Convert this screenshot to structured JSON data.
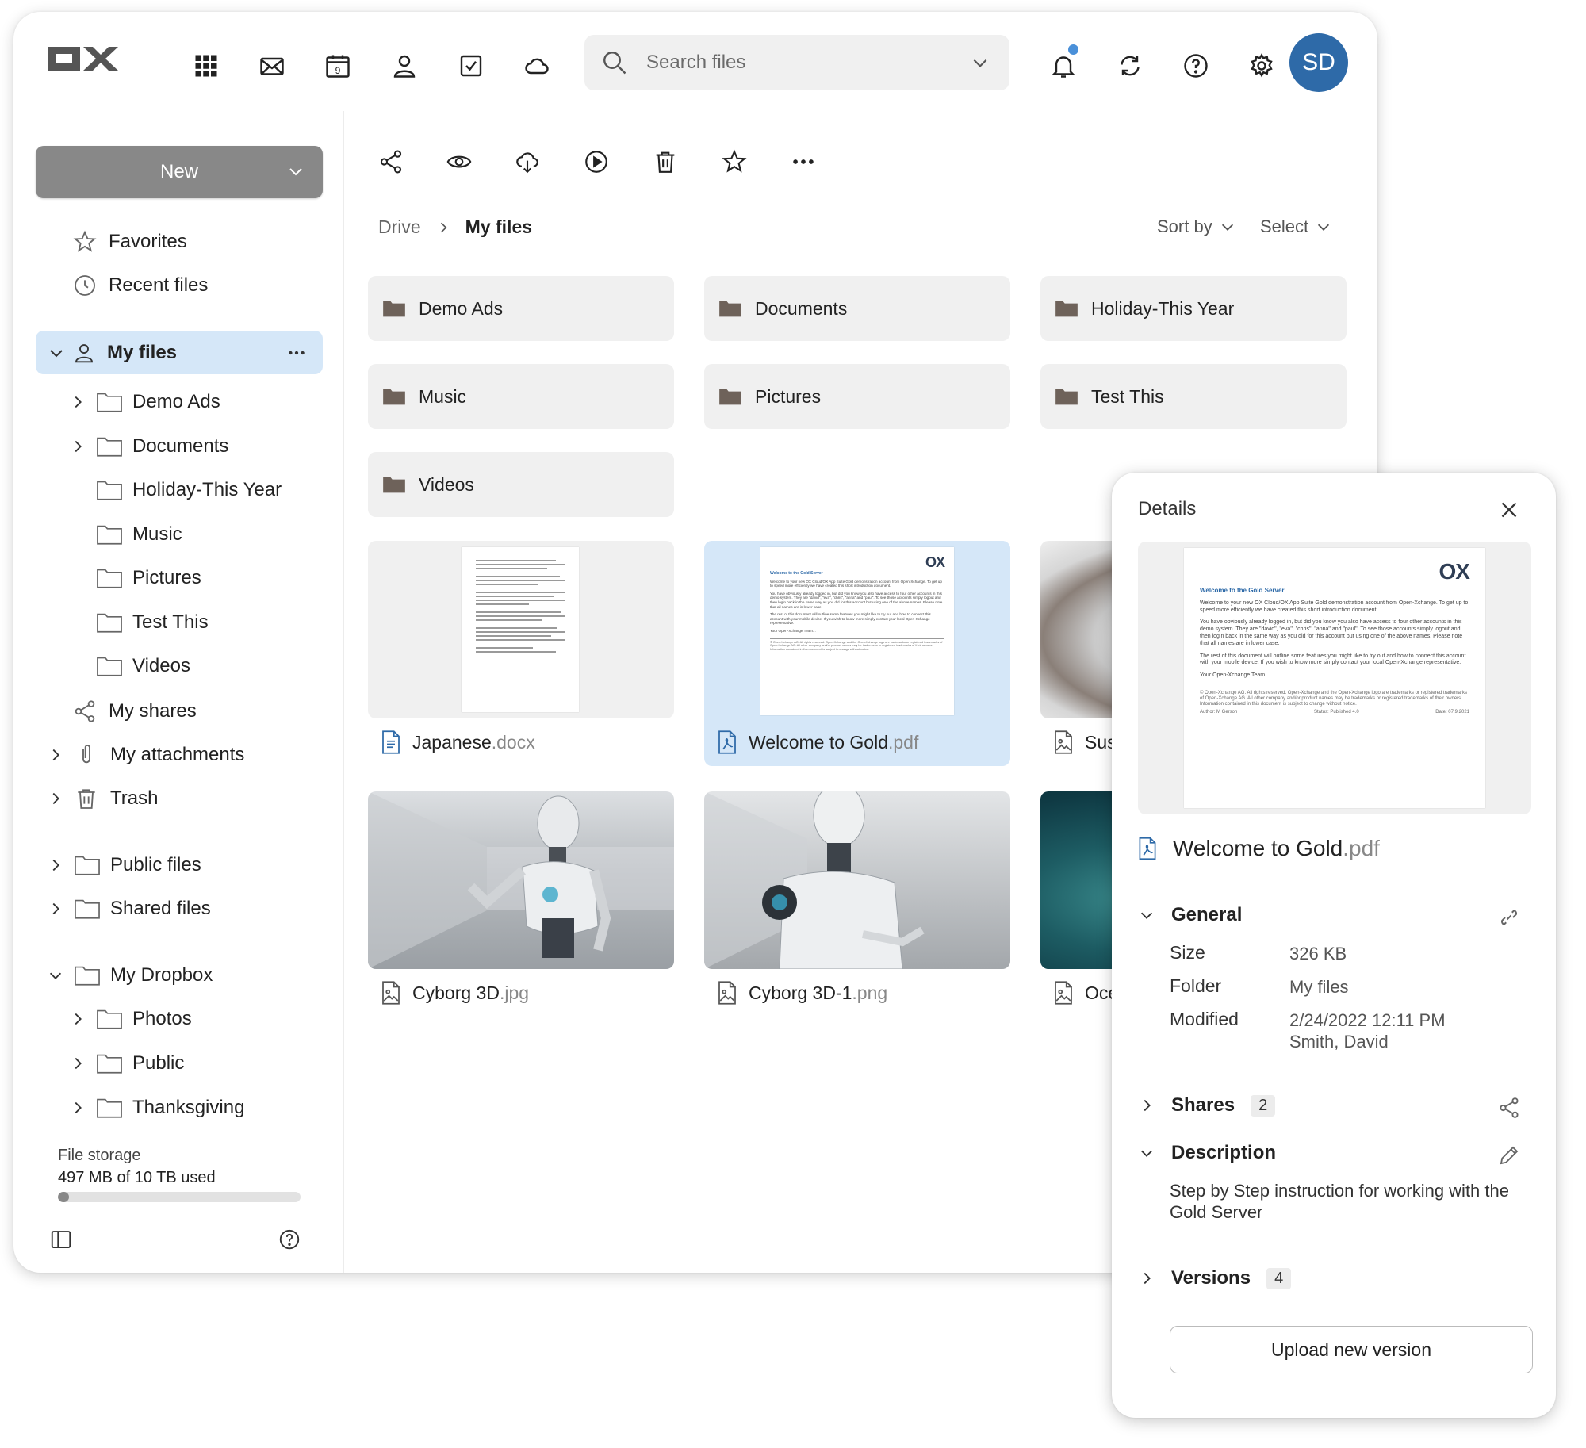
{
  "topbar": {
    "logo_text": "OX",
    "apps": [
      {
        "icon": "grid-icon"
      },
      {
        "icon": "mail-icon"
      },
      {
        "icon": "calendar-icon",
        "badge": "9"
      },
      {
        "icon": "contacts-icon"
      },
      {
        "icon": "tasks-icon"
      },
      {
        "icon": "cloud-icon"
      }
    ],
    "search": {
      "placeholder": "Search files",
      "value": ""
    },
    "avatar_initials": "SD",
    "colors": {
      "accent": "#2e6aa8",
      "selection": "#d5e7f8",
      "notification": "#4a90d9"
    }
  },
  "sidebar": {
    "new_label": "New",
    "favorites": "Favorites",
    "recent": "Recent files",
    "my_files": "My files",
    "my_files_children": [
      "Demo Ads",
      "Documents",
      "Holiday-This Year",
      "Music",
      "Pictures",
      "Test This",
      "Videos"
    ],
    "my_shares": "My shares",
    "my_attachments": "My attachments",
    "trash": "Trash",
    "public_files": "Public files",
    "shared_files": "Shared files",
    "my_dropbox": "My Dropbox",
    "dropbox_children": [
      "Photos",
      "Public",
      "Thanksgiving"
    ],
    "storage": {
      "title": "File storage",
      "value": "497 MB of 10 TB used",
      "used_fraction": 0.0001
    }
  },
  "main": {
    "breadcrumb": {
      "root": "Drive",
      "current": "My files"
    },
    "sort_label": "Sort by",
    "select_label": "Select",
    "folders": [
      "Demo Ads",
      "Documents",
      "Holiday-This Year",
      "Music",
      "Pictures",
      "Test This",
      "Videos"
    ],
    "files": [
      {
        "base": "Japanese",
        "ext": ".docx"
      },
      {
        "base": "Welcome to Gold",
        "ext": ".pdf"
      },
      {
        "base": "Sush",
        "ext": ""
      },
      {
        "base": "Cyborg 3D",
        "ext": ".jpg"
      },
      {
        "base": "Cyborg 3D-1",
        "ext": ".png"
      },
      {
        "base": "Oce",
        "ext": ""
      }
    ],
    "doc_preview": {
      "logo": "OX",
      "heading": "Welcome to the Gold Server",
      "p1": "Welcome to your new OX Cloud/OX App Suite Gold demonstration account from Open-Xchange. To get up to speed more efficiently we have created this short introduction document.",
      "p2": "You have obviously already logged in, but did you know you also have access to four other accounts in this demo system. They are \"david\", \"eva\", \"chris\", \"anna\" and \"paul\". To see those accounts simply logout and then login back in the same way as you did for this account but using one of the above names. Please note that all names are in lower case.",
      "p3": "The rest of this document will outline some features you might like to try out and how to connect this account with your mobile device. If you wish to know more simply contact your local Open-Xchange representative.",
      "p4": "Your Open-Xchange Team...",
      "footer": "© Open-Xchange AG. All rights reserved. Open-Xchange and the Open-Xchange logo are trademarks or registered trademarks of Open-Xchange AG. All other company and/or product names may be trademarks or registered trademarks of their owners. Information contained in this document is subject to change without notice.",
      "author": "Author: M Gerson",
      "status": "Status: Published 4.0",
      "date": "Date: 07.9.2021"
    }
  },
  "details": {
    "title": "Details",
    "file_base": "Welcome to Gold",
    "file_ext": ".pdf",
    "general": "General",
    "size_label": "Size",
    "size_value": "326 KB",
    "folder_label": "Folder",
    "folder_value": "My files",
    "modified_label": "Modified",
    "modified_value": "2/24/2022 12:11 PM",
    "modified_by": "Smith, David",
    "shares": "Shares",
    "shares_count": "2",
    "description": "Description",
    "description_text": "Step by Step instruction for working with the Gold Server",
    "versions": "Versions",
    "versions_count": "4",
    "upload_label": "Upload new version"
  }
}
